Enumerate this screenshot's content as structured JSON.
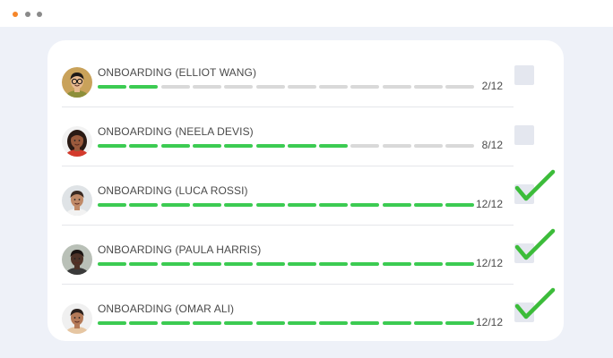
{
  "window": {
    "controls": [
      {
        "name": "close",
        "color": "#f5862a"
      },
      {
        "name": "minimize",
        "color": "#8a8a8a"
      },
      {
        "name": "maximize",
        "color": "#8a8a8a"
      }
    ]
  },
  "colors": {
    "progress_done": "#3ccb52",
    "progress_todo": "#d9d9d9",
    "check": "#3cbc3a",
    "checkbox": "#e4e7ef"
  },
  "tasks": [
    {
      "title": "ONBOARDING (ELLIOT WANG)",
      "done": 2,
      "total": 12,
      "progress_label": "2/12",
      "completed": false,
      "avatar": "person-avatar-elliot"
    },
    {
      "title": "ONBOARDING (NEELA DEVIS)",
      "done": 8,
      "total": 12,
      "progress_label": "8/12",
      "completed": false,
      "avatar": "person-avatar-neela"
    },
    {
      "title": "ONBOARDING (LUCA ROSSI)",
      "done": 12,
      "total": 12,
      "progress_label": "12/12",
      "completed": true,
      "avatar": "person-avatar-luca"
    },
    {
      "title": "ONBOARDING (PAULA HARRIS)",
      "done": 12,
      "total": 12,
      "progress_label": "12/12",
      "completed": true,
      "avatar": "person-avatar-paula"
    },
    {
      "title": "ONBOARDING (OMAR ALI)",
      "done": 12,
      "total": 12,
      "progress_label": "12/12",
      "completed": true,
      "avatar": "person-avatar-omar"
    }
  ]
}
